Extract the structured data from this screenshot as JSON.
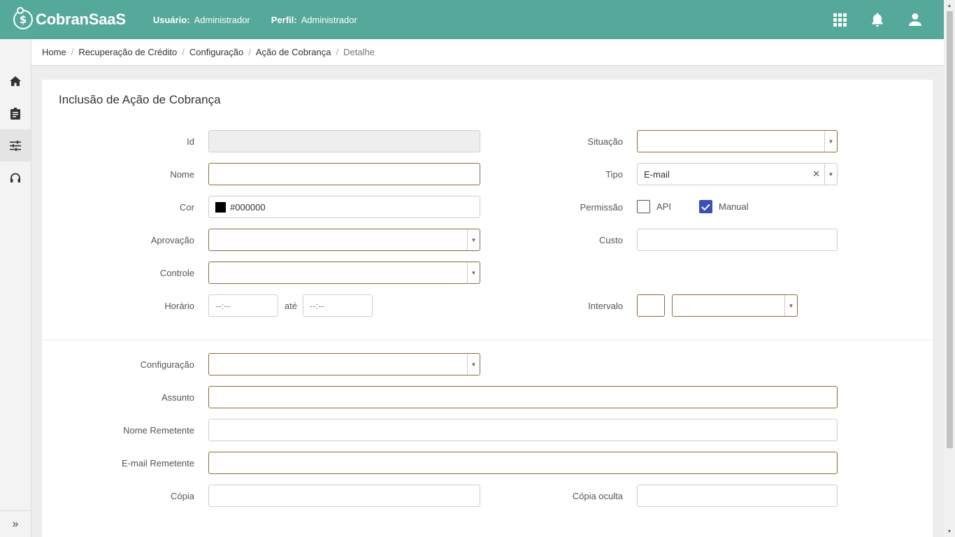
{
  "header": {
    "app_name": "CobranSaaS",
    "user_label": "Usuário:",
    "user_value": "Administrador",
    "profile_label": "Perfil:",
    "profile_value": "Administrador",
    "icons": [
      "apps-grid-icon",
      "bell-icon",
      "user-icon"
    ],
    "bg_color": "#55a99a"
  },
  "sidebar": {
    "items": [
      "home-icon",
      "clipboard-icon",
      "sliders-icon",
      "headset-icon"
    ],
    "expand_label": "»"
  },
  "breadcrumb": [
    "Home",
    "Recuperação de Crédito",
    "Configuração",
    "Ação de Cobrança",
    "Detalhe"
  ],
  "form": {
    "title": "Inclusão de Ação de Cobrança",
    "labels": {
      "id": "Id",
      "nome": "Nome",
      "cor": "Cor",
      "aprovacao": "Aprovação",
      "controle": "Controle",
      "horario": "Horário",
      "ate": "até",
      "situacao": "Situação",
      "tipo": "Tipo",
      "permissao": "Permissão",
      "custo": "Custo",
      "intervalo": "Intervalo",
      "configuracao": "Configuração",
      "assunto": "Assunto",
      "nome_remetente": "Nome Remetente",
      "email_remetente": "E-mail Remetente",
      "copia": "Cópia",
      "copia_oculta": "Cópia oculta"
    },
    "values": {
      "cor": "#000000",
      "tipo": "E-mail",
      "horario_inicio_placeholder": "--:--",
      "horario_fim_placeholder": "--:--"
    },
    "permissao": {
      "api_label": "API",
      "api_checked": false,
      "manual_label": "Manual",
      "manual_checked": true
    }
  }
}
